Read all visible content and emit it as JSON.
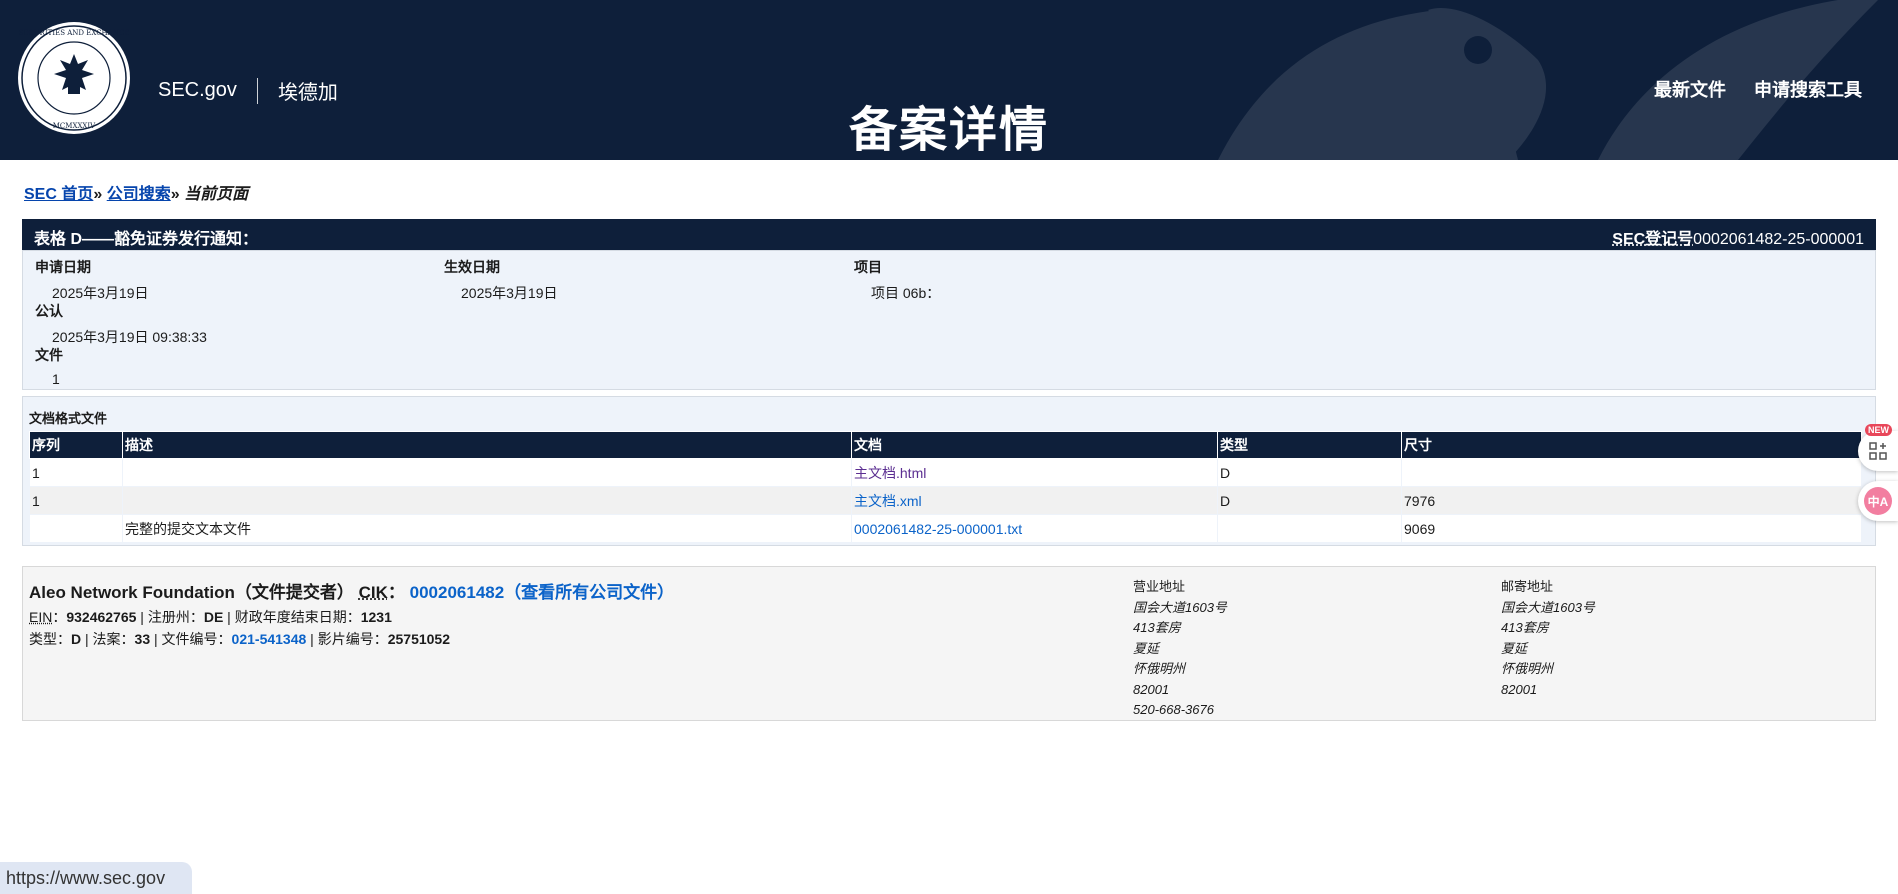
{
  "header": {
    "brand": "SEC.gov",
    "brand_sub": "埃德加",
    "title": "备案详情",
    "nav": [
      "最新文件",
      "申请搜索工具"
    ]
  },
  "breadcrumb": {
    "home": "SEC 首页",
    "sep1": "»",
    "company_search": "公司搜索",
    "sep2": "»",
    "current": "当前页面"
  },
  "form": {
    "title": "表格 D——豁免证券发行通知：",
    "accno_label": "SEC登记号",
    "accno_value": "0002061482-25-000001",
    "filing_date_label": "申请日期",
    "filing_date": "2025年3月19日",
    "accepted_label": "公认",
    "accepted": "2025年3月19日 09:38:33",
    "documents_label": "文件",
    "documents": "1",
    "period_label": "生效日期",
    "period": "2025年3月19日",
    "items_label": "项目",
    "items": "项目 06b："
  },
  "docs": {
    "caption": "文档格式文件",
    "headers": [
      "序列",
      "描述",
      "文档",
      "类型",
      "尺寸"
    ],
    "rows": [
      {
        "seq": "1",
        "desc": "",
        "doc": "主文档.html",
        "type": "D",
        "size": ""
      },
      {
        "seq": "1",
        "desc": "",
        "doc": "主文档.xml",
        "type": "D",
        "size": "7976"
      },
      {
        "seq": "",
        "desc": "完整的提交文本文件",
        "doc": "0002061482-25-000001.txt",
        "type": "",
        "size": "9069"
      }
    ]
  },
  "filer": {
    "name": "Aleo Network Foundation（文件提交者）",
    "cik_label": "CIK",
    "cik_colon": "：",
    "cik_link": "0002061482（查看所有公司文件）",
    "ein_label": "EIN",
    "ein_colon": "：",
    "ein": "932462765",
    "state_label": " | 注册州：",
    "state": "DE",
    "fy_label": " | 财政年度结束日期：",
    "fy": "1231",
    "type_label": "类型：",
    "type": "D",
    "act_label": " | 法案：",
    "act": "33",
    "file_no_label": " | 文件编号：",
    "file_no": "021-541348",
    "film_label": " | 影片编号：",
    "film": "25751052",
    "business_address": {
      "title": "营业地址",
      "lines": [
        "国会大道1603号",
        "413套房",
        "夏延",
        "怀俄明州",
        "82001",
        "520-668-3676"
      ]
    },
    "mailing_address": {
      "title": "邮寄地址",
      "lines": [
        "国会大道1603号",
        "413套房",
        "夏延",
        "怀俄明州",
        "82001"
      ]
    }
  },
  "status_bar": {
    "url": "https://www.sec.gov"
  },
  "side_tools": {
    "badge": "NEW",
    "translate_label": "中A"
  },
  "colors": {
    "header_bg": "#0e1f3a",
    "link": "#0b63c9",
    "visited": "#5b2e91",
    "panel_bg": "#eef3fa"
  }
}
